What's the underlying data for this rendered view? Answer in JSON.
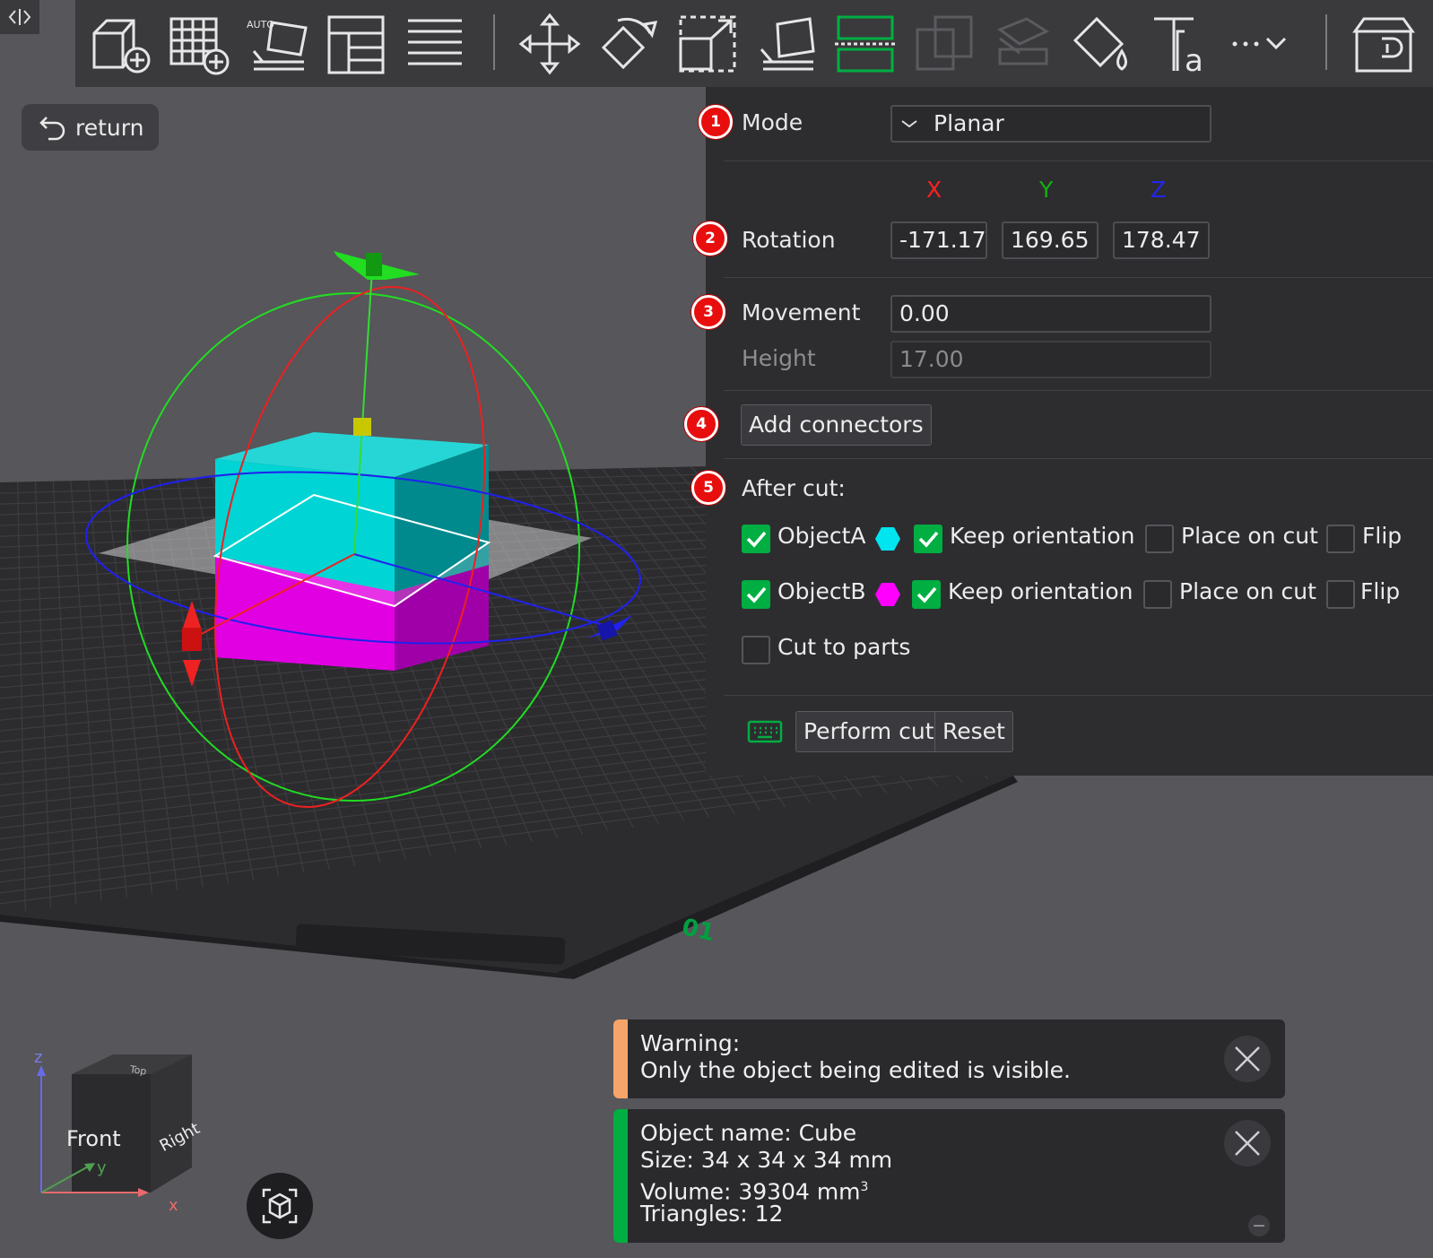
{
  "toolbar": {
    "buttons": [
      {
        "name": "add-cube",
        "icon": "cube-add-icon"
      },
      {
        "name": "add-plate",
        "icon": "grid-add-icon"
      },
      {
        "name": "auto-orient",
        "icon": "auto-orient-icon",
        "badge": "AUTO"
      },
      {
        "name": "arrange",
        "icon": "arrange-icon"
      },
      {
        "name": "slice-layers",
        "icon": "layers-icon"
      },
      {
        "name": "move",
        "icon": "move-icon"
      },
      {
        "name": "rotate",
        "icon": "rotate-icon"
      },
      {
        "name": "scale",
        "icon": "scale-icon"
      },
      {
        "name": "lay-on-face",
        "icon": "lay-on-face-icon"
      },
      {
        "name": "cut",
        "icon": "cut-icon",
        "active": true
      },
      {
        "name": "boolean",
        "icon": "boolean-icon",
        "disabled": true
      },
      {
        "name": "support-paint",
        "icon": "support-paint-icon",
        "disabled": true
      },
      {
        "name": "color-paint",
        "icon": "paint-bucket-icon"
      },
      {
        "name": "text",
        "icon": "text-icon"
      },
      {
        "name": "more",
        "icon": "more-icon"
      },
      {
        "name": "assembly",
        "icon": "assembly-icon"
      }
    ]
  },
  "viewport": {
    "return_label": "return",
    "view_cube": {
      "front": "Front",
      "right": "Right",
      "top": "Top",
      "axis_x": "x",
      "axis_y": "y",
      "axis_z": "z"
    },
    "plate_number": "01"
  },
  "panel": {
    "badges": [
      "1",
      "2",
      "3",
      "4",
      "5"
    ],
    "mode_label": "Mode",
    "mode_value": "Planar",
    "axes": {
      "x": "X",
      "y": "Y",
      "z": "Z"
    },
    "rotation_label": "Rotation",
    "rotation": {
      "x": "-171.17",
      "y": "169.65",
      "z": "178.47"
    },
    "movement_label": "Movement",
    "movement_value": "0.00",
    "height_label": "Height",
    "height_value": "17.00",
    "add_connectors_label": "Add connectors",
    "after_cut_label": "After cut:",
    "object_a": {
      "label": "ObjectA",
      "checked": true,
      "color": "#00e5f0",
      "keep_orientation": "Keep orientation",
      "keep_checked": true,
      "place_on_cut": "Place on cut",
      "place_checked": false,
      "flip": "Flip",
      "flip_checked": false
    },
    "object_b": {
      "label": "ObjectB",
      "checked": true,
      "color": "#ff00ff",
      "keep_orientation": "Keep orientation",
      "keep_checked": true,
      "place_on_cut": "Place on cut",
      "place_checked": false,
      "flip": "Flip",
      "flip_checked": false
    },
    "cut_to_parts_label": "Cut to parts",
    "cut_to_parts_checked": false,
    "perform_cut_label": "Perform cut",
    "reset_label": "Reset"
  },
  "notifications": {
    "warning": {
      "line1": "Warning:",
      "line2": "Only the object being edited is visible.",
      "color": "#f4a460"
    },
    "info": {
      "line1": "Object name: Cube",
      "line2": "Size: 34 x 34 x 34 mm",
      "line3": "Volume: 39304 mm",
      "line3_sup": "3",
      "line4": "Triangles: 12",
      "color": "#00ae42"
    }
  },
  "colors": {
    "accent": "#00ae42",
    "axis_x": "#ff2020",
    "axis_y": "#00b000",
    "axis_z": "#2020ff",
    "object_a": "#00d6d6",
    "object_b": "#e000e0"
  }
}
